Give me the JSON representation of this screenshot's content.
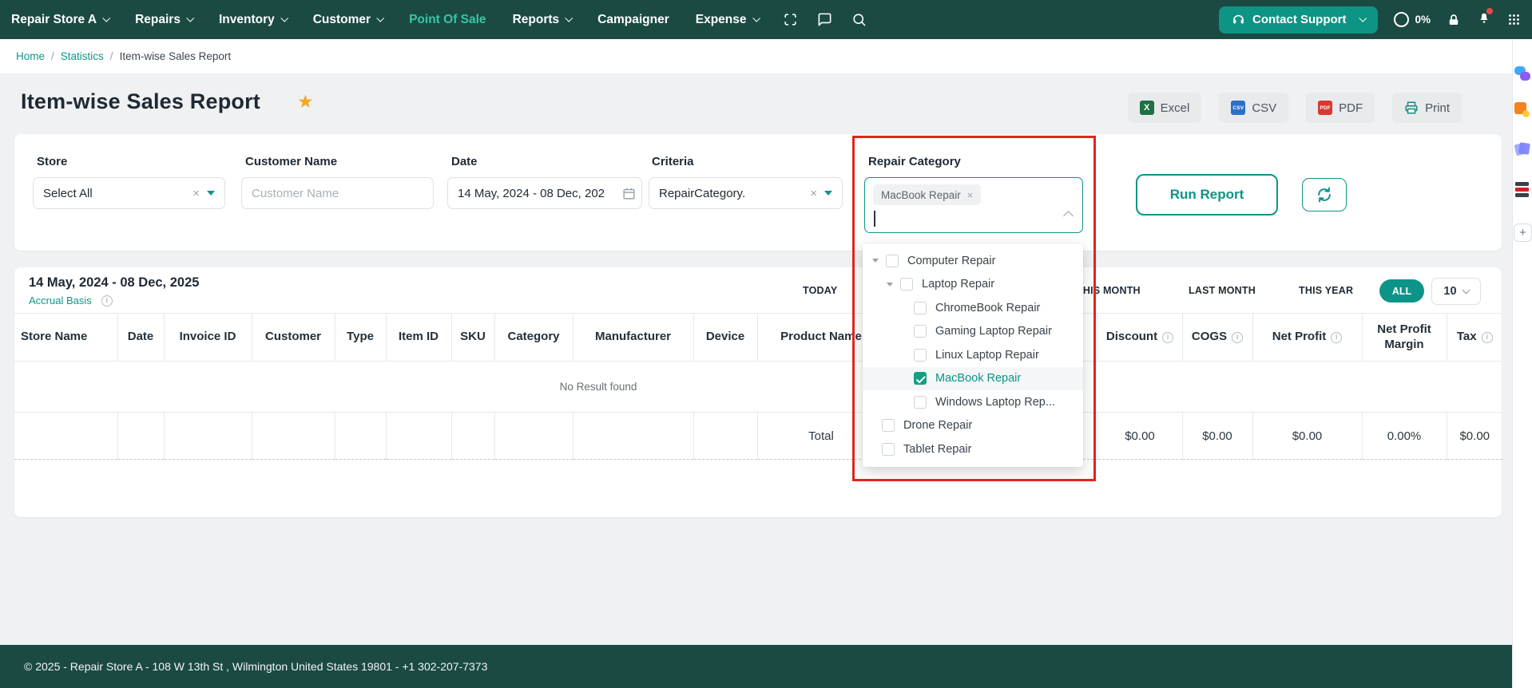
{
  "colors": {
    "navbar": "#1b4a42",
    "accent": "#0d9488",
    "active_nav": "#36c6a4",
    "annotation_red": "#e1251b",
    "star": "#f5a623"
  },
  "navbar": {
    "items": [
      {
        "label": "Repair Store A",
        "caret": true
      },
      {
        "label": "Repairs",
        "caret": true
      },
      {
        "label": "Inventory",
        "caret": true
      },
      {
        "label": "Customer",
        "caret": true
      },
      {
        "label": "Point Of Sale",
        "caret": false,
        "active": true
      },
      {
        "label": "Reports",
        "caret": true
      },
      {
        "label": "Campaigner",
        "caret": false
      },
      {
        "label": "Expense",
        "caret": true
      }
    ],
    "icons": [
      "scan-icon",
      "chat-icon",
      "search-icon",
      "headset-icon",
      "lock-icon",
      "bell-icon",
      "grid-icon"
    ],
    "contact_support_label": "Contact Support",
    "usage_percent": "0%"
  },
  "breadcrumb": {
    "home": "Home",
    "section": "Statistics",
    "current": "Item-wise Sales Report"
  },
  "page": {
    "title": "Item-wise Sales Report"
  },
  "export_buttons": {
    "excel": "Excel",
    "csv": "CSV",
    "pdf": "PDF",
    "print": "Print",
    "excel_badge": "X",
    "csv_badge": "CSV",
    "pdf_badge": "PDF"
  },
  "filters": {
    "store": {
      "label": "Store",
      "value": "Select All"
    },
    "customer": {
      "label": "Customer Name",
      "placeholder": "Customer Name"
    },
    "date": {
      "label": "Date",
      "value": "14 May, 2024 - 08 Dec, 202"
    },
    "criteria": {
      "label": "Criteria",
      "value": "RepairCategory."
    },
    "repair_category": {
      "label": "Repair Category",
      "selected_tag": "MacBook Repair"
    },
    "run_report_label": "Run Report"
  },
  "category_dropdown": {
    "items": [
      {
        "label": "Computer Repair",
        "level": 0,
        "arrow": true,
        "checked": false
      },
      {
        "label": "Laptop Repair",
        "level": 1,
        "arrow": true,
        "checked": false
      },
      {
        "label": "ChromeBook Repair",
        "level": 2,
        "arrow": false,
        "checked": false
      },
      {
        "label": "Gaming Laptop Repair",
        "level": 2,
        "arrow": false,
        "checked": false
      },
      {
        "label": "Linux Laptop Repair",
        "level": 2,
        "arrow": false,
        "checked": false
      },
      {
        "label": "MacBook Repair",
        "level": 2,
        "arrow": false,
        "checked": true
      },
      {
        "label": "Windows Laptop Rep...",
        "level": 2,
        "arrow": false,
        "checked": false
      },
      {
        "label": "Drone Repair",
        "level": 0,
        "arrow": false,
        "checked": false
      },
      {
        "label": "Tablet Repair",
        "level": 0,
        "arrow": false,
        "checked": false
      }
    ]
  },
  "report": {
    "date_range": "14 May, 2024 - 08 Dec, 2025",
    "basis": "Accrual Basis",
    "period_buttons": {
      "today": "TODAY",
      "this_month": "THIS MONTH",
      "last_month": "LAST MONTH",
      "this_year": "THIS YEAR",
      "all": "ALL"
    },
    "active_period": "ALL",
    "page_size": "10"
  },
  "table": {
    "columns": [
      {
        "label": "Store Name",
        "info": false
      },
      {
        "label": "Date",
        "info": false
      },
      {
        "label": "Invoice ID",
        "info": false
      },
      {
        "label": "Customer",
        "info": false
      },
      {
        "label": "Type",
        "info": false
      },
      {
        "label": "Item ID",
        "info": false
      },
      {
        "label": "SKU",
        "info": false
      },
      {
        "label": "Category",
        "info": false
      },
      {
        "label": "Manufacturer",
        "info": false
      },
      {
        "label": "Device",
        "info": false
      },
      {
        "label": "Product Name",
        "info": false
      },
      {
        "label": "",
        "info": false
      },
      {
        "label": "Discount",
        "info": true
      },
      {
        "label": "COGS",
        "info": true
      },
      {
        "label": "Net Profit",
        "info": true
      },
      {
        "label": "Net Profit Margin",
        "info": false
      },
      {
        "label": "Tax",
        "info": true
      }
    ],
    "empty_message": "No Result found",
    "total": {
      "label": "Total",
      "discount": "$0.00",
      "cogs": "$0.00",
      "net_profit": "$0.00",
      "margin": "0.00%",
      "tax": "$0.00"
    }
  },
  "footer": {
    "text": "© 2025 - Repair Store A - 108 W 13th St , Wilmington United States 19801 - +1 302-207-7373"
  }
}
